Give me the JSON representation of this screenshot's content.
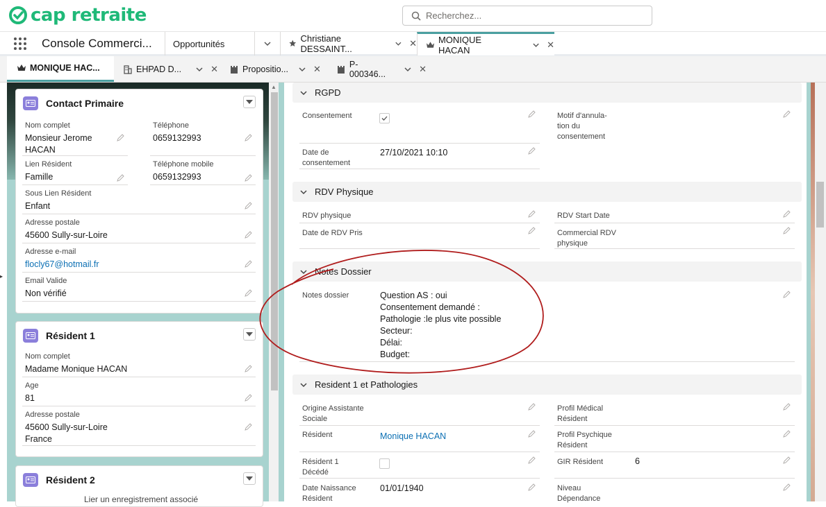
{
  "header": {
    "logo_text": "cap retraite",
    "search_placeholder": "Recherchez..."
  },
  "nav": {
    "app_name": "Console Commerci...",
    "tabs": [
      {
        "label": "Opportunités"
      },
      {
        "label": "Christiane DESSAINT..."
      },
      {
        "label": "MONIQUE HACAN"
      }
    ]
  },
  "subtabs": [
    {
      "label": "MONIQUE HAC..."
    },
    {
      "label": "EHPAD D..."
    },
    {
      "label": "Propositio..."
    },
    {
      "label": "P-000346..."
    }
  ],
  "cards": {
    "contact": {
      "title": "Contact Primaire",
      "nom_label": "Nom complet",
      "nom_value_1": "Monsieur Jerome",
      "nom_value_2": "HACAN",
      "tel_label": "Téléphone",
      "tel_value": "0659132993",
      "lien_label": "Lien Résident",
      "lien_value": "Famille",
      "telmob_label": "Téléphone mobile",
      "telmob_value": "0659132993",
      "souslien_label": "Sous Lien Résident",
      "souslien_value": "Enfant",
      "adresse_label": "Adresse postale",
      "adresse_value": "45600 Sully-sur-Loire",
      "email_label": "Adresse e-mail",
      "email_value": "flocly67@hotmail.fr",
      "emailvalide_label": "Email Valide",
      "emailvalide_value": "Non vérifié"
    },
    "resident1": {
      "title": "Résident 1",
      "nom_label": "Nom complet",
      "nom_value": "Madame Monique HACAN",
      "age_label": "Age",
      "age_value": "81",
      "adresse_label": "Adresse postale",
      "adresse_value_1": "45600 Sully-sur-Loire",
      "adresse_value_2": "France"
    },
    "resident2": {
      "title": "Résident 2",
      "footer_text": "Lier un enregistrement associé"
    }
  },
  "sections": {
    "rgpd": {
      "title": "RGPD",
      "consent_label": "Consentement",
      "motif_label_1": "Motif d'annula-",
      "motif_label_2": "tion du",
      "motif_label_3": "consentement",
      "date_label_1": "Date de",
      "date_label_2": "consentement",
      "date_value": "27/10/2021 10:10"
    },
    "rdv": {
      "title": "RDV Physique",
      "rdv_label": "RDV physique",
      "start_label": "RDV Start Date",
      "pris_label": "Date de RDV Pris",
      "commercial_label_1": "Commercial RDV",
      "commercial_label_2": "physique"
    },
    "notes": {
      "title": "Notes Dossier",
      "label": "Notes dossier",
      "lines": [
        "Question AS : oui",
        "Consentement demandé :",
        "Pathologie :le plus vite possible",
        "Secteur:",
        "Délai:",
        "Budget:"
      ]
    },
    "resident": {
      "title": "Resident 1 et Pathologies",
      "origine_label_1": "Origine Assistante",
      "origine_label_2": "Sociale",
      "profil_med_label_1": "Profil Médical",
      "profil_med_label_2": "Résident",
      "resident_label": "Résident",
      "resident_value": "Monique HACAN",
      "profil_psy_label_1": "Profil Psychique",
      "profil_psy_label_2": "Résident",
      "decede_label_1": "Résident 1",
      "decede_label_2": "Décédé",
      "gir_label": "GIR Résident",
      "gir_value": "6",
      "naissance_label_1": "Date Naissance",
      "naissance_label_2": "Résident",
      "naissance_value": "01/01/1940",
      "niveau_label_1": "Niveau",
      "niveau_label_2": "Dépendance"
    }
  },
  "colors": {
    "brand": "#1fb978",
    "accent_teal": "#4a9fa0",
    "card_icon": "#8b7fdb",
    "link": "#0b6fb3",
    "annotation": "#b01c1c"
  }
}
